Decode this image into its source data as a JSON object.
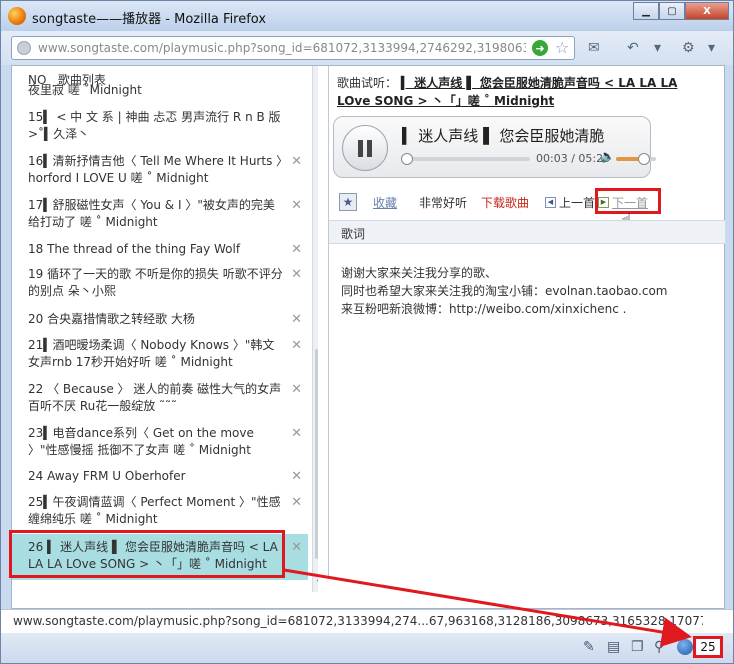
{
  "window": {
    "title": "songtaste——播放器 - Mozilla Firefox",
    "controls": {
      "minimize": "▁",
      "maximize": "▢",
      "close": "X"
    }
  },
  "navbar": {
    "url": "www.songtaste.com/playmusic.php?song_id=681072,3133994,2746292,3198063,3195762,3025"
  },
  "playlist": {
    "header": "NO   歌曲列表",
    "items": [
      {
        "text": "夜里寂 嗟  ˚Midnight",
        "del": ""
      },
      {
        "text": "15▍  < 中 文 系  | 神曲 忐忑 男声流行 R n B 版 >˚▍久泽丶",
        "del": ""
      },
      {
        "text": "16▍清新抒情吉他〈    Tell Me Where It Hurts     〉horford I LOVE U 嗟 ˚ Midnight",
        "del": "✕"
      },
      {
        "text": "17▍舒服磁性女声〈    You & I    〉\"被女声的完美给打动了 嗟 ˚ Midnight",
        "del": "✕"
      },
      {
        "text": "18 The thread of the thing Fay Wolf",
        "del": "✕"
      },
      {
        "text": "19 循环了一天的歌 不听是你的损失 听歌不评分的别点 朵丶小熙",
        "del": "✕"
      },
      {
        "text": "20 合央嘉措情歌之转经歌 大杨",
        "del": "✕"
      },
      {
        "text": "21▍酒吧暧场柔调〈    Nobody Knows    〉\"韩文女声rnb 17秒开始好听 嗟 ˚ Midnight",
        "del": "✕"
      },
      {
        "text": "22 〈    Because    〉  迷人的前奏   磁性大气的女声百听不厌   Ru花一般绽放   ˜˜˜",
        "del": "✕"
      },
      {
        "text": "23▍电音dance系列〈    Get on the move    〉\"性感慢摇 抵御不了女声 嗟 ˚ Midnight",
        "del": "✕"
      },
      {
        "text": "24 Away FRM U Oberhofer",
        "del": "✕"
      },
      {
        "text": "25▍午夜调情蓝调〈    Perfect Moment    〉\"性感缠绵纯乐 嗟 ˚ Midnight",
        "del": "✕"
      },
      {
        "text": "26 ▍   迷人声线   ▌   您会臣服她清脆声音吗  < LA LA LA LOve SONG > 丶「」嗟 ˚ Midnight",
        "del": "✕"
      }
    ]
  },
  "player": {
    "trial_label": "歌曲试听：",
    "trial_title": "▍  迷人声线  ▌   您会臣服她清脆声音吗  < LA LA LA LOve SONG > 丶「」嗟 ˚ Midnight",
    "now_playing": "▍   迷人声线   ▌   您会臣服她清脆",
    "time": "00:03 / 05:25",
    "progress": 0.01,
    "volume": 0.7,
    "actions": {
      "favorite": "收藏",
      "very_good": "非常好听",
      "download": "下载歌曲",
      "prev": "上一首",
      "next": "下一首"
    },
    "lyrics_header": "歌词",
    "lyrics": [
      "谢谢大家来关注我分享的歌、",
      "同时也希望大家来关注我的淘宝小铺：evolnan.taobao.com",
      "来互粉吧新浪微博：http://weibo.com/xinxichenc ."
    ]
  },
  "status": {
    "url": "www.songtaste.com/playmusic.php?song_id=681072,3133994,274...67,963168,3128186,3098673,3165328,1707731,3182503,3036396#"
  },
  "addonbar": {
    "count": "25"
  },
  "colors": {
    "highlight": "#e0191e",
    "active_row": "#a8dde2",
    "download": "#c8261a"
  }
}
